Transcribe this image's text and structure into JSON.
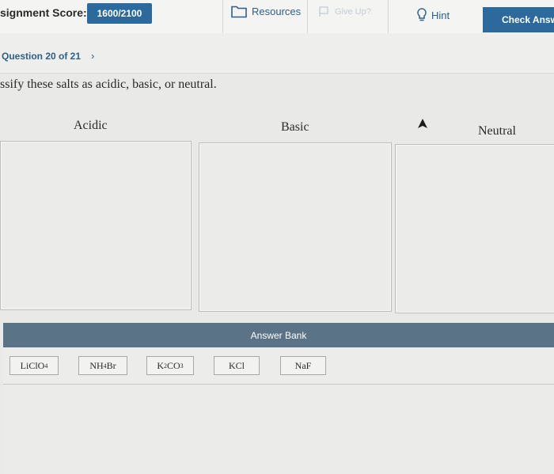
{
  "toolbar": {
    "score_label": "signment Score:",
    "score_value": "1600/2100",
    "resources_label": "Resources",
    "giveup_label": "Give Up?",
    "hint_label": "Hint",
    "check_label": "Check Answ",
    "colors": {
      "accent": "#2c6a9e",
      "link": "#2c5f8a",
      "disabled": "#c5ccd3"
    }
  },
  "question_nav": {
    "text": "Question 20 of 21",
    "next_icon": "chevron-right-icon"
  },
  "prompt": "ssify these salts as acidic, basic, or neutral.",
  "categories": [
    {
      "label": "Acidic"
    },
    {
      "label": "Basic"
    },
    {
      "label": "Neutral"
    }
  ],
  "answer_bank": {
    "title": "Answer Bank",
    "tiles": [
      {
        "base": "LiClO",
        "sub": "4",
        "rest": ""
      },
      {
        "base": "NH",
        "sub": "4",
        "rest": "Br"
      },
      {
        "base": "K",
        "sub": "2",
        "rest": "CO",
        "sub2": "3"
      },
      {
        "base": "KCl",
        "sub": "",
        "rest": ""
      },
      {
        "base": "NaF",
        "sub": "",
        "rest": ""
      }
    ]
  }
}
